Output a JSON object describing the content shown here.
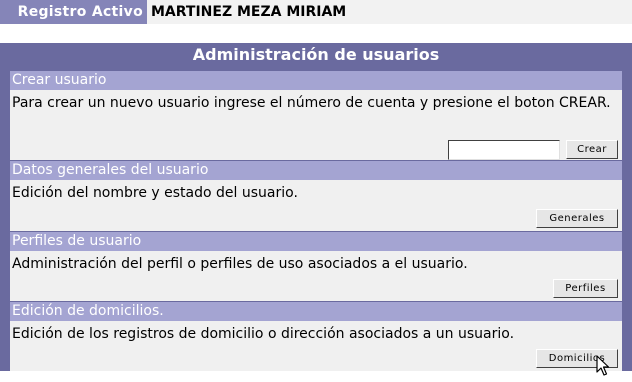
{
  "header": {
    "label": "Registro Activo",
    "user_name": "MARTINEZ MEZA MIRIAM"
  },
  "panel": {
    "title": "Administración de usuarios"
  },
  "sections": [
    {
      "heading": "Crear usuario",
      "description": "Para crear un nuevo usuario ingrese el número de cuenta y presione el boton CREAR.",
      "input_value": "",
      "button": "Crear"
    },
    {
      "heading": "Datos generales del usuario",
      "description": "Edición del nombre y estado del usuario.",
      "button": "Generales"
    },
    {
      "heading": "Perfiles de usuario",
      "description": "Administración del perfil o perfiles de uso asociados a el usuario.",
      "button": "Perfiles"
    },
    {
      "heading": "Edición de domicilios.",
      "description": "Edición de los registros de domicilio o dirección asociados a un usuario.",
      "button": "Domicilios"
    }
  ],
  "icons": {
    "cursor": "mouse-pointer-icon"
  }
}
